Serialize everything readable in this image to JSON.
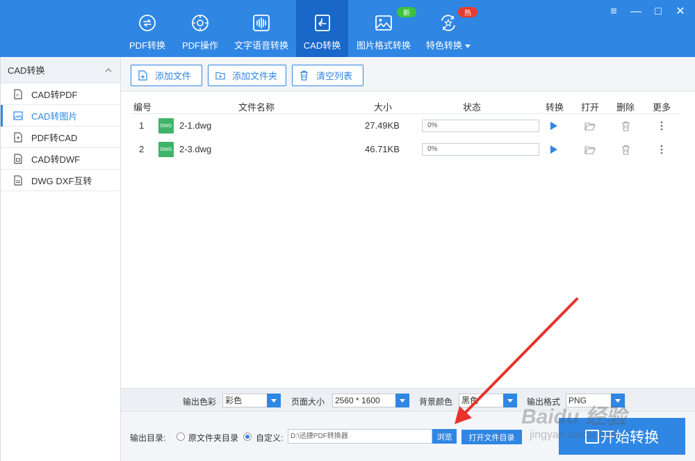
{
  "window": {
    "controls": [
      "≡",
      "—",
      "□",
      "✕"
    ]
  },
  "tabs": [
    {
      "label": "PDF转换",
      "icon": "pdf-convert-icon"
    },
    {
      "label": "PDF操作",
      "icon": "pdf-operate-icon"
    },
    {
      "label": "文字语音转换",
      "icon": "voice-wave-icon"
    },
    {
      "label": "CAD转换",
      "icon": "cad-convert-icon",
      "active": true
    },
    {
      "label": "图片格式转换",
      "icon": "image-icon",
      "badge": "新"
    },
    {
      "label": "特色转换",
      "icon": "star-convert-icon",
      "badge": "热"
    }
  ],
  "sidebar": {
    "title": "CAD转换",
    "items": [
      {
        "label": "CAD转PDF"
      },
      {
        "label": "CAD转图片",
        "active": true
      },
      {
        "label": "PDF转CAD"
      },
      {
        "label": "CAD转DWF"
      },
      {
        "label": "DWG DXF互转"
      }
    ]
  },
  "toolbar": {
    "add_file": "添加文件",
    "add_folder": "添加文件夹",
    "clear_list": "清空列表"
  },
  "table": {
    "headers": {
      "num": "编号",
      "name": "文件名称",
      "size": "大小",
      "status": "状态",
      "convert": "转换",
      "open": "打开",
      "delete": "删除",
      "more": "更多"
    },
    "rows": [
      {
        "num": "1",
        "icon_text": "DWG",
        "name": "2-1.dwg",
        "size": "27.49KB",
        "progress": "0%"
      },
      {
        "num": "2",
        "icon_text": "DWG",
        "name": "2-3.dwg",
        "size": "46.71KB",
        "progress": "0%"
      }
    ]
  },
  "settings": {
    "color_label": "输出色彩",
    "color_value": "彩色",
    "page_label": "页面大小",
    "page_value": "2560 * 1600",
    "bg_label": "背景颜色",
    "bg_value": "黑色",
    "format_label": "输出格式",
    "format_value": "PNG"
  },
  "output": {
    "label": "输出目录:",
    "option_original": "原文件夹目录",
    "option_custom": "自定义:",
    "path": "D:\\迅捷PDF转换器",
    "browse": "浏览",
    "open_dir": "打开文件目录",
    "start": "开始转换"
  },
  "watermark": {
    "line1": "Baidu 经验",
    "line2": "jingyan.baidu.com"
  },
  "colors": {
    "primary": "#2f86e3",
    "tab_active": "#1867c9",
    "annotation_arrow": "#e8322a"
  }
}
